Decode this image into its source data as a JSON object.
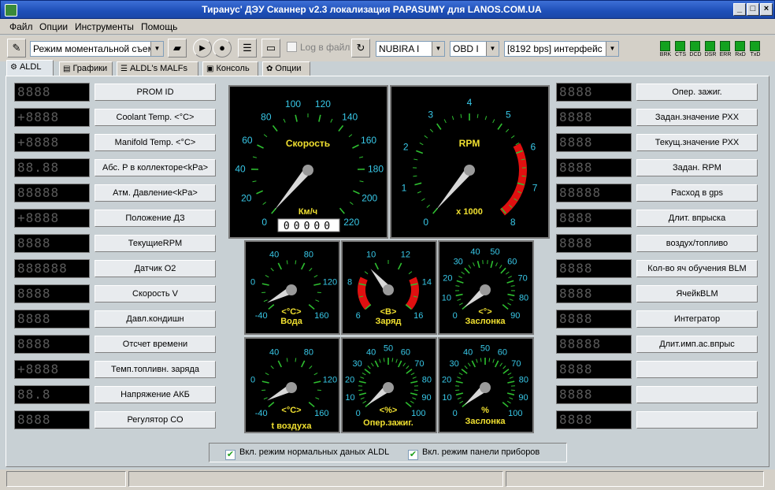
{
  "window": {
    "title": "Тиранус' ДЭУ Сканнер v2.3 локализация PAPASUMY для LANOS.COM.UA",
    "buttons": [
      "_",
      "□",
      "×"
    ]
  },
  "menu": [
    "Файл",
    "Опции",
    "Инструменты",
    "Помощь"
  ],
  "toolbar": {
    "mode_select": "Режим моментальной съем",
    "log_label": "Log в файл",
    "car_select": "NUBIRA I",
    "protocol_select": "OBD I",
    "interface_select": "[8192 bps] интерфейс",
    "leds": [
      "BRK",
      "CTS",
      "DCD",
      "DSR",
      "ERR",
      "RxD",
      "TxD"
    ],
    "led_color": "#13a21f"
  },
  "tabs": [
    "ALDL",
    "Графики",
    "ALDL's MALFs",
    "Консоль",
    "Опции"
  ],
  "left_params": [
    {
      "label": "PROM ID",
      "display": "8888"
    },
    {
      "label": "Coolant Temp. <°C>",
      "display": "+8888"
    },
    {
      "label": "Manifold Temp. <°C>",
      "display": "+8888"
    },
    {
      "label": "Абс. P в коллекторе<kPa>",
      "display": "88.88"
    },
    {
      "label": "Атм. Давление<kPa>",
      "display": "88888"
    },
    {
      "label": "Положение ДЗ",
      "display": "+8888"
    },
    {
      "label": "ТекущиеRPM",
      "display": "8888"
    },
    {
      "label": "Датчик О2",
      "display": "888888"
    },
    {
      "label": "Скорость V",
      "display": "8888"
    },
    {
      "label": "Давл.кондишн",
      "display": "8888"
    },
    {
      "label": "Отсчет времени",
      "display": "8888"
    },
    {
      "label": "Темп.топливн. заряда",
      "display": "+8888"
    },
    {
      "label": "Напряжение АКБ",
      "display": "88.8"
    },
    {
      "label": "Регулятор СО",
      "display": "8888"
    }
  ],
  "right_params": [
    {
      "label": "Опер. зажиг.",
      "display": "8888"
    },
    {
      "label": "Задан.значение РХХ",
      "display": "8888"
    },
    {
      "label": "Текущ.значение РХХ",
      "display": "8888"
    },
    {
      "label": "Задан. RPM",
      "display": "8888"
    },
    {
      "label": "Расход в gps",
      "display": "88888"
    },
    {
      "label": "Длит. впрыска",
      "display": "8888"
    },
    {
      "label": "воздух/топливо",
      "display": "8888"
    },
    {
      "label": "Кол-во яч обучения BLM",
      "display": "8888"
    },
    {
      "label": "ЯчейкBLM",
      "display": "8888"
    },
    {
      "label": "Интегратор",
      "display": "8888"
    },
    {
      "label": "Длит.имп.ас.впрыс",
      "display": "88888"
    },
    {
      "label": "",
      "display": "8888"
    },
    {
      "label": "",
      "display": "8888"
    },
    {
      "label": "",
      "display": "8888"
    }
  ],
  "gauges": {
    "speed": {
      "title": "Скорость",
      "unit": "Км/ч",
      "ticks": [
        "0",
        "20",
        "40",
        "60",
        "80",
        "100",
        "120",
        "140",
        "160",
        "180",
        "200",
        "220"
      ],
      "odometer": "00000",
      "value": 0
    },
    "rpm": {
      "title": "RPM",
      "unit": "x 1000",
      "ticks": [
        "0",
        "1",
        "2",
        "3",
        "4",
        "5",
        "6",
        "7",
        "8"
      ],
      "value": 0
    },
    "water": {
      "title": "<°C>",
      "caption": "Вода",
      "ticks": [
        "-40",
        "0",
        "40",
        "80",
        "120",
        "160"
      ]
    },
    "battery": {
      "title": "<B>",
      "caption": "Заряд",
      "ticks": [
        "6",
        "8",
        "10",
        "12",
        "14",
        "16"
      ]
    },
    "throttle": {
      "title": "<°>",
      "caption": "Заслонка",
      "ticks": [
        "0",
        "10",
        "20",
        "30",
        "40",
        "50",
        "60",
        "70",
        "80",
        "90"
      ]
    },
    "air": {
      "title": "<°C>",
      "caption": "t воздуха",
      "ticks": [
        "-40",
        "0",
        "40",
        "80",
        "120",
        "160"
      ]
    },
    "ignition": {
      "title": "<%>",
      "caption": "Опер.зажиг.",
      "ticks": [
        "0",
        "10",
        "20",
        "30",
        "40",
        "50",
        "60",
        "70",
        "80",
        "90",
        "100"
      ]
    },
    "throttle_pct": {
      "title": "%",
      "caption": "Заслонка",
      "ticks": [
        "0",
        "10",
        "20",
        "30",
        "40",
        "50",
        "60",
        "70",
        "80",
        "90",
        "100"
      ]
    }
  },
  "options": {
    "normal_mode": "Вкл. режим нормальных даных ALDL",
    "dashboard_mode": "Вкл. режим панели приборов"
  },
  "colors": {
    "scale_text": "#38c8e8",
    "title_text": "#f0e030",
    "redline": "#e01010",
    "tick": "#2ec030"
  }
}
